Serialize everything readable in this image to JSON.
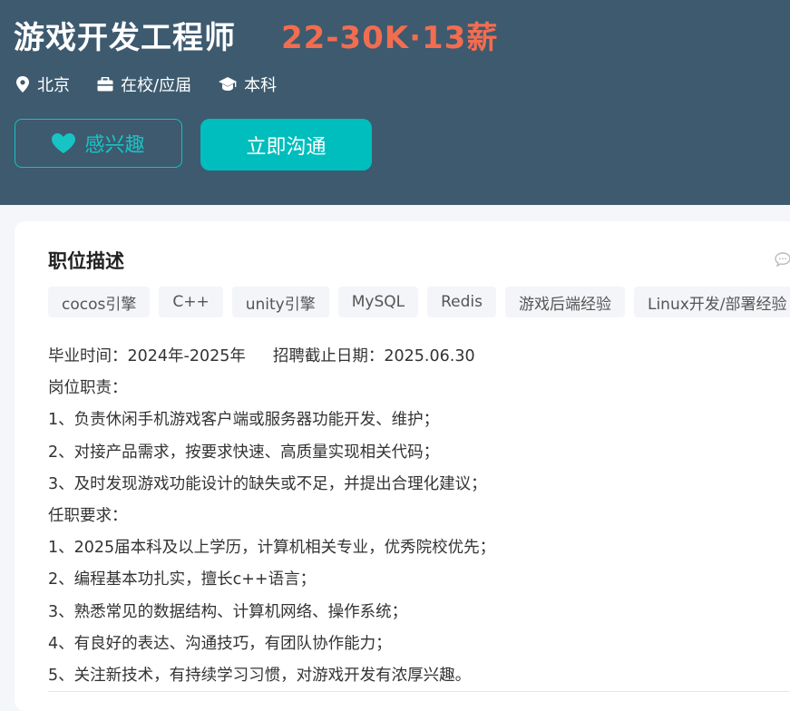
{
  "job": {
    "title": "游戏开发工程师",
    "salary": "22-30K·13薪"
  },
  "meta": {
    "city": "北京",
    "experience": "在校/应届",
    "degree": "本科"
  },
  "actions": {
    "interest_label": "感兴趣",
    "chat_label": "立即沟通"
  },
  "description": {
    "section_title": "职位描述",
    "tags": [
      "cocos引擎",
      "C++",
      "unity引擎",
      "MySQL",
      "Redis",
      "游戏后端经验",
      "Linux开发/部署经验"
    ],
    "graduation": "毕业时间：2024年-2025年",
    "deadline": "招聘截止日期：2025.06.30",
    "lines": [
      "岗位职责：",
      "1、负责休闲手机游戏客户端或服务器功能开发、维护；",
      "2、对接产品需求，按要求快速、高质量实现相关代码；",
      "3、及时发现游戏功能设计的缺失或不足，并提出合理化建议；",
      "任职要求：",
      "1、2025届本科及以上学历，计算机相关专业，优秀院校优先；",
      "2、编程基本功扎实，擅长c++语言；",
      "3、熟悉常见的数据结构、计算机网络、操作系统；",
      "4、有良好的表达、沟通技巧，有团队协作能力；",
      "5、关注新技术，有持续学习习惯，对游戏开发有浓厚兴趣。"
    ]
  },
  "colors": {
    "header_bg": "#3d5a6f",
    "salary": "#f26d50",
    "accent": "#00bebd"
  },
  "icons": {
    "location": "location-pin-icon",
    "experience": "briefcase-icon",
    "degree": "graduation-cap-icon",
    "interest": "heart-icon",
    "chat": "chat-bubble-icon"
  }
}
